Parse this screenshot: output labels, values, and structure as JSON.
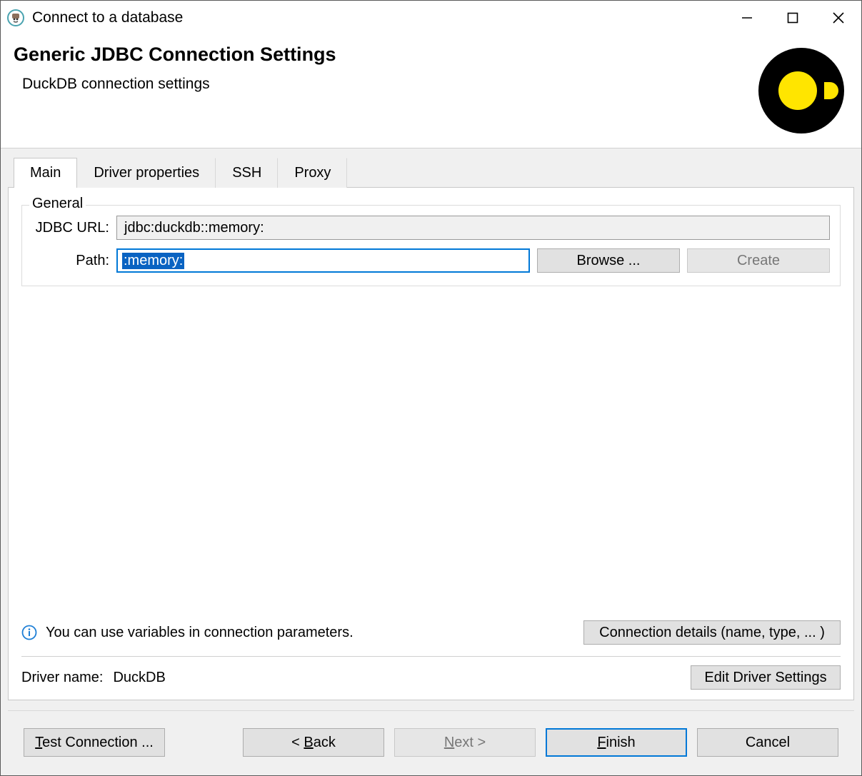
{
  "window": {
    "title": "Connect to a database"
  },
  "header": {
    "title": "Generic JDBC Connection Settings",
    "subtitle": "DuckDB connection settings"
  },
  "tabs": [
    {
      "label": "Main",
      "active": true
    },
    {
      "label": "Driver properties",
      "active": false
    },
    {
      "label": "SSH",
      "active": false
    },
    {
      "label": "Proxy",
      "active": false
    }
  ],
  "general": {
    "legend": "General",
    "jdbc_url_label": "JDBC URL:",
    "jdbc_url_value": "jdbc:duckdb::memory:",
    "path_label": "Path:",
    "path_value": ":memory:",
    "browse_label": "Browse ...",
    "create_label": "Create",
    "create_disabled": true
  },
  "info": {
    "text": "You can use variables in connection parameters.",
    "connection_details_label": "Connection details (name, type, ... )"
  },
  "driver": {
    "label": "Driver name:",
    "value": "DuckDB",
    "edit_label": "Edit Driver Settings"
  },
  "footer": {
    "test_label_prefix_underline": "T",
    "test_label_rest": "est Connection ...",
    "back_prefix": "< ",
    "back_underline": "B",
    "back_rest": "ack",
    "next_underline": "N",
    "next_rest": "ext >",
    "next_disabled": true,
    "finish_underline": "F",
    "finish_rest": "inish",
    "cancel_label": "Cancel"
  }
}
